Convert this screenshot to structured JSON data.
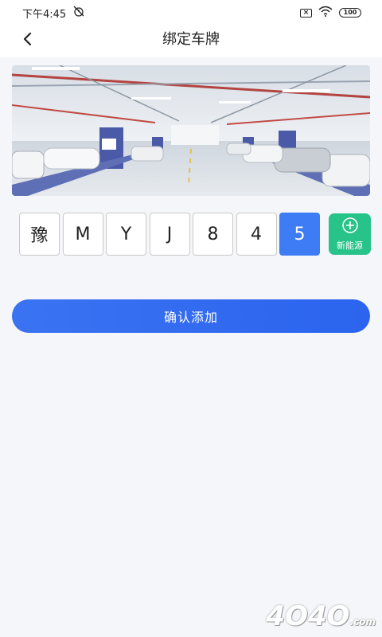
{
  "status_bar": {
    "time": "下午4:45",
    "battery": "100",
    "icons": [
      "alarm-off-icon",
      "sim-x-icon",
      "wifi-icon",
      "battery-icon"
    ]
  },
  "header": {
    "back_icon": "chevron-left-icon",
    "title": "绑定车牌"
  },
  "banner": {
    "subject": "parking-garage-photo"
  },
  "plate": {
    "chars": [
      "豫",
      "M",
      "Y",
      "J",
      "8",
      "4",
      "5"
    ],
    "active_index": 6
  },
  "new_energy": {
    "icon": "plus-circle-icon",
    "label": "新能源"
  },
  "confirm_button": {
    "label": "确认添加"
  },
  "watermark": {
    "text": "4O4O",
    "suffix": ".com"
  },
  "colors": {
    "accent": "#3d7cf4",
    "new_energy": "#27c389",
    "background": "#f5f6fa"
  }
}
